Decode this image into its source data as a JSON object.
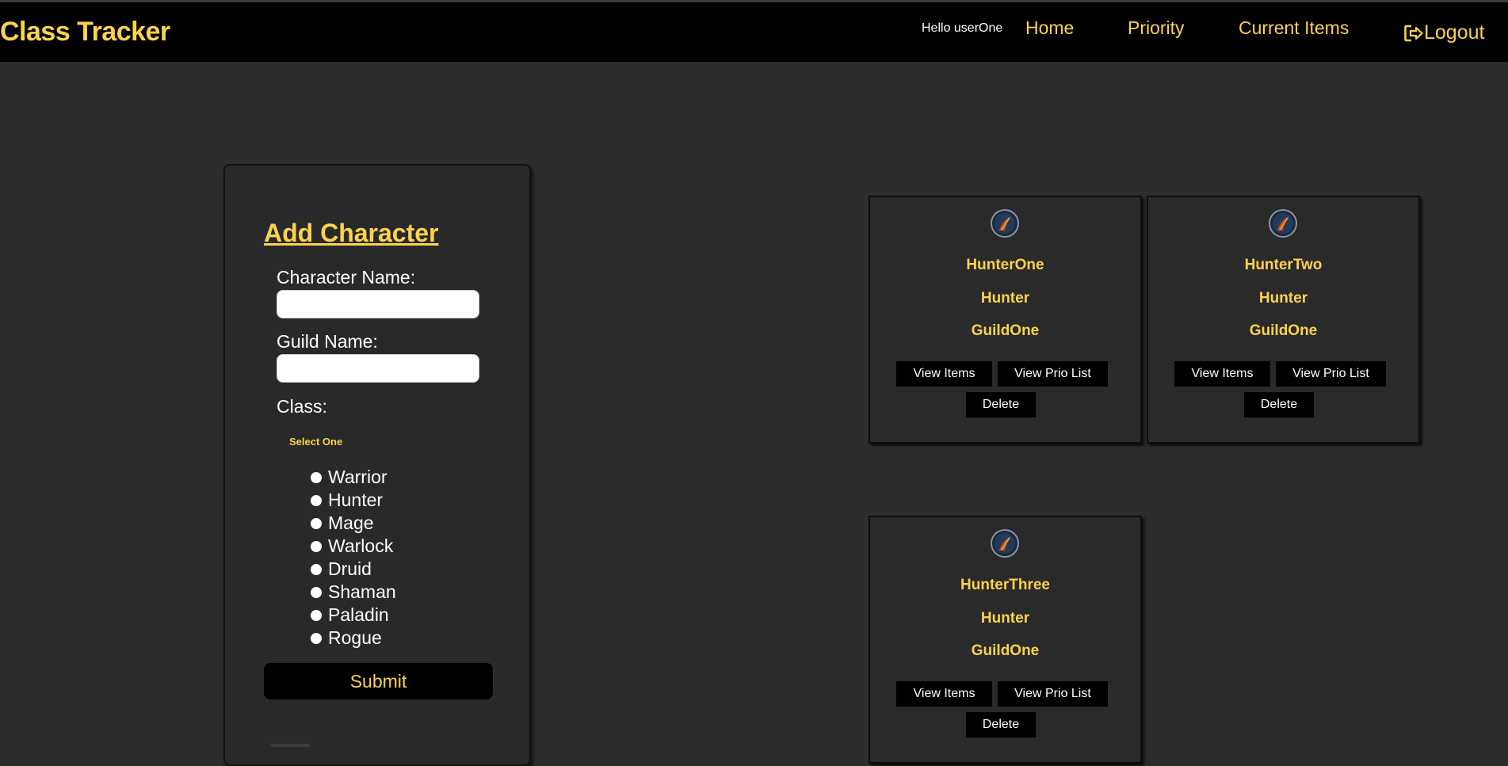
{
  "nav": {
    "brand": "Class Tracker",
    "greeting": "Hello userOne",
    "links": [
      "Home",
      "Priority",
      "Current Items"
    ],
    "logout_label": "Logout"
  },
  "form": {
    "title": "Add Character",
    "character_name_label": "Character Name:",
    "character_name_value": "",
    "guild_name_label": "Guild Name:",
    "guild_name_value": "",
    "class_label": "Class:",
    "select_hint": "Select One",
    "classes": [
      "Warrior",
      "Hunter",
      "Mage",
      "Warlock",
      "Druid",
      "Shaman",
      "Paladin",
      "Rogue"
    ],
    "submit_label": "Submit"
  },
  "characters": [
    {
      "name": "HunterOne",
      "class": "Hunter",
      "guild": "GuildOne",
      "icon": "hunter-class-icon"
    },
    {
      "name": "HunterTwo",
      "class": "Hunter",
      "guild": "GuildOne",
      "icon": "hunter-class-icon"
    },
    {
      "name": "HunterThree",
      "class": "Hunter",
      "guild": "GuildOne",
      "icon": "hunter-class-icon"
    }
  ],
  "card_buttons": {
    "view_items": "View Items",
    "view_prio": "View Prio List",
    "delete": "Delete"
  },
  "colors": {
    "accent": "#fcd34d",
    "background": "#2d2d2d",
    "navbar": "#000000"
  }
}
